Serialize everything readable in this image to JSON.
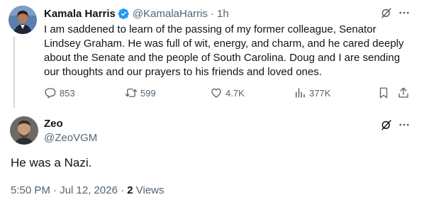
{
  "parent_tweet": {
    "author_name": "Kamala Harris",
    "handle": "@KamalaHarris",
    "separator": "·",
    "time": "1h",
    "text": "I am saddened to learn of the passing of my former colleague, Senator Lindsey Graham. He was full of wit, energy, and charm, and he cared deeply about the Senate and the people of South Carolina. Doug and I are sending our thoughts and our prayers to his friends and loved ones.",
    "stats": {
      "replies": "853",
      "retweets": "599",
      "likes": "4.7K",
      "views": "377K"
    },
    "verified_color": "#1d9bf0"
  },
  "reply_tweet": {
    "author_name": "Zeo",
    "handle": "@ZeoVGM",
    "text": "He was a Nazi.",
    "timestamp": "5:50 PM · Jul 12, 2026 · ",
    "views_count": "2",
    "views_label": " Views"
  },
  "icons": [
    "verified-badge-icon",
    "grok-icon",
    "more-icon",
    "reply-icon",
    "retweet-icon",
    "like-icon",
    "views-icon",
    "bookmark-icon",
    "share-icon"
  ],
  "colors": {
    "text": "#0f1419",
    "secondary": "#536471",
    "accent": "#1d9bf0",
    "thread_line": "#cfd9de"
  }
}
